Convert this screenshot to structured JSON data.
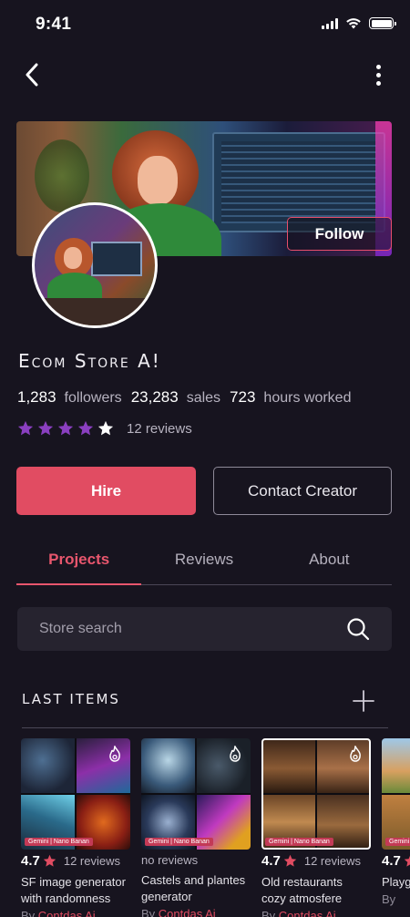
{
  "status_bar": {
    "time": "9:41"
  },
  "profile": {
    "follow_label": "Follow",
    "store_name": "Ecom Store A!",
    "stats": [
      {
        "value": "1,283",
        "label": "followers"
      },
      {
        "value": "23,283",
        "label": "sales"
      },
      {
        "value": "723",
        "label": "hours worked"
      }
    ],
    "rating": 4,
    "rating_max": 5,
    "reviews": "12 reviews",
    "hire_label": "Hire",
    "contact_label": "Contact Creator"
  },
  "tabs": [
    {
      "label": "Projects",
      "active": true
    },
    {
      "label": "Reviews",
      "active": false
    },
    {
      "label": "About",
      "active": false
    }
  ],
  "search": {
    "placeholder": "Store search"
  },
  "section": {
    "title": "LAST ITEMS"
  },
  "items": [
    {
      "tag": "Gemini | Nano Banan",
      "rating": "4.7",
      "reviews": "12 reviews",
      "title_line1": "SF image generator",
      "title_line2": "with randomness",
      "by": "By",
      "author": "Contdas Ai"
    },
    {
      "tag": "Gemini | Nano Banan",
      "rating": "",
      "reviews": "no reviews",
      "title_line1": "Castels and plantes",
      "title_line2": "generator",
      "by": "By",
      "author": "Contdas Ai"
    },
    {
      "tag": "Gemini | Nano Banan",
      "rating": "4.7",
      "reviews": "12 reviews",
      "title_line1": "Old restaurants",
      "title_line2": "cozy atmosfere",
      "by": "By",
      "author": "Contdas Ai"
    },
    {
      "tag": "Gemini",
      "rating": "4.7",
      "reviews": "",
      "title_line1": "Playg",
      "title_line2": "",
      "by": "By",
      "author": ""
    }
  ],
  "colors": {
    "accent": "#e14c62",
    "background": "#17141f",
    "star": "#8a3fc0"
  }
}
